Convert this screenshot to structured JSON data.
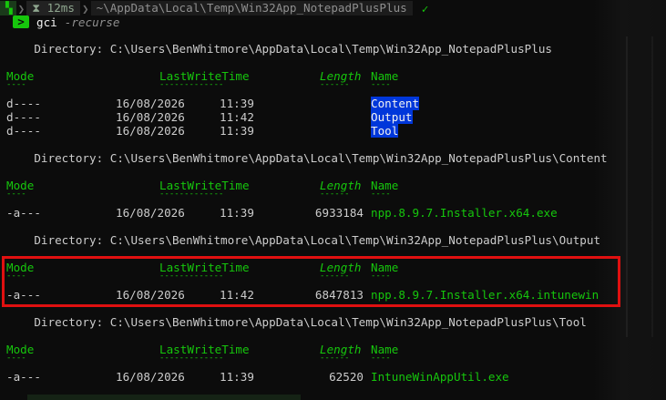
{
  "prompt": {
    "time": "12ms",
    "path": "~\\AppData\\Local\\Temp\\Win32App_NotepadPlusPlus",
    "command": "gci",
    "argument": "-recurse"
  },
  "headers": {
    "mode": "Mode",
    "lastwritetime": "LastWriteTime",
    "length": "Length",
    "name": "Name"
  },
  "underlines": {
    "mode": "----",
    "lastwritetime": "-------------",
    "length": "------",
    "name": "----"
  },
  "listings": [
    {
      "directory": "    Directory: C:\\Users\\BenWhitmore\\AppData\\Local\\Temp\\Win32App_NotepadPlusPlus",
      "rows": [
        {
          "mode": "d----",
          "date": "16/08/2026",
          "time": "11:39",
          "length": "",
          "name": "Content"
        },
        {
          "mode": "d----",
          "date": "16/08/2026",
          "time": "11:42",
          "length": "",
          "name": "Output"
        },
        {
          "mode": "d----",
          "date": "16/08/2026",
          "time": "11:39",
          "length": "",
          "name": "Tool"
        }
      ]
    },
    {
      "directory": "    Directory: C:\\Users\\BenWhitmore\\AppData\\Local\\Temp\\Win32App_NotepadPlusPlus\\Content",
      "rows": [
        {
          "mode": "-a---",
          "date": "16/08/2026",
          "time": "11:39",
          "length": "6933184",
          "name": "npp.8.9.7.Installer.x64.exe"
        }
      ]
    },
    {
      "directory": "    Directory: C:\\Users\\BenWhitmore\\AppData\\Local\\Temp\\Win32App_NotepadPlusPlus\\Output",
      "rows": [
        {
          "mode": "-a---",
          "date": "16/08/2026",
          "time": "11:42",
          "length": "6847813",
          "name": "npp.8.9.7.Installer.x64.intunewin"
        }
      ]
    },
    {
      "directory": "    Directory: C:\\Users\\BenWhitmore\\AppData\\Local\\Temp\\Win32App_NotepadPlusPlus\\Tool",
      "rows": [
        {
          "mode": "-a---",
          "date": "16/08/2026",
          "time": "11:39",
          "length": "62520",
          "name": "IntuneWinAppUtil.exe"
        }
      ]
    }
  ]
}
